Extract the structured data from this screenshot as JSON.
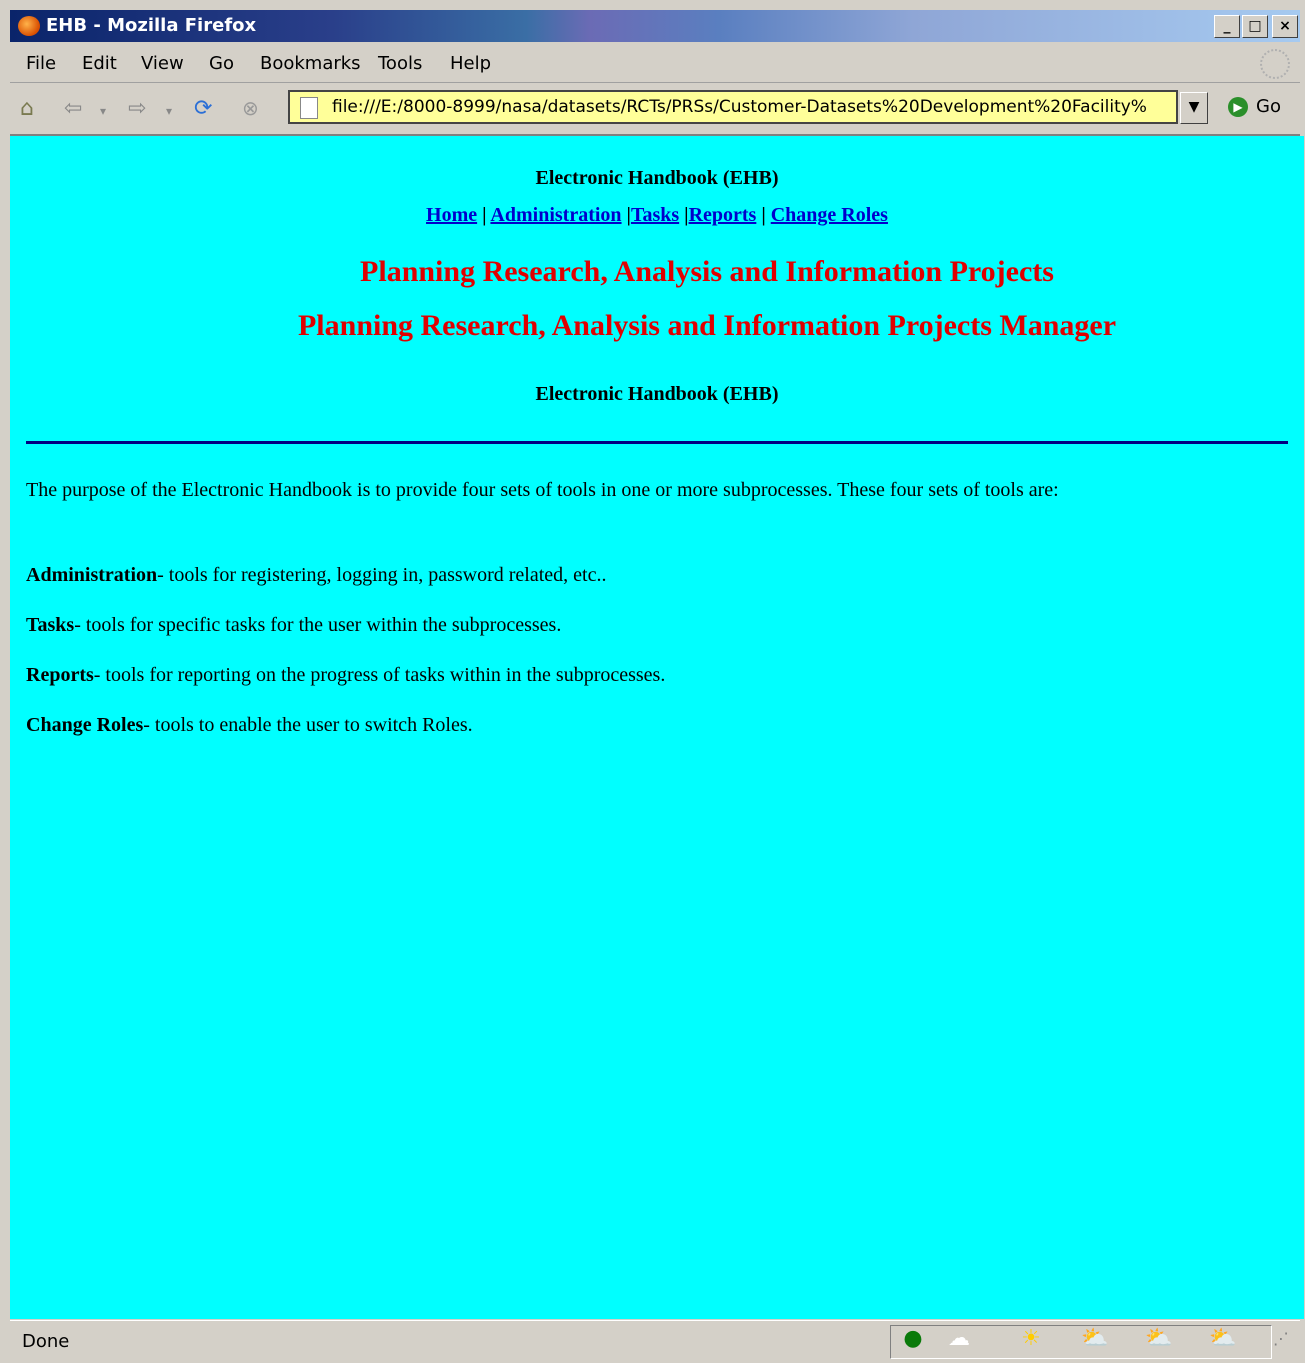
{
  "window": {
    "title": "EHB - Mozilla Firefox",
    "minimize": "_",
    "maximize": "□",
    "close": "×"
  },
  "menu": [
    "File",
    "Edit",
    "View",
    "Go",
    "Bookmarks",
    "Tools",
    "Help"
  ],
  "toolbar": {
    "url": "file:///E:/8000-8999/nasa/datasets/RCTs/PRSs/Customer-Datasets%20Development%20Facility%",
    "go_label": "Go"
  },
  "page": {
    "ehb_top": "Electronic Handbook (EHB)",
    "nav": {
      "home": "Home",
      "administration": "Administration",
      "tasks": "Tasks",
      "reports": "Reports",
      "change_roles": "Change Roles",
      "sep": "|"
    },
    "heading1": "Planning Research, Analysis and Information Projects",
    "heading2": "Planning Research, Analysis and Information Projects Manager",
    "ehb_bottom": "Electronic Handbook (EHB)",
    "intro": "The purpose of the Electronic Handbook is to provide four sets of tools in one or more subprocesses. These four sets of tools are:",
    "items": [
      {
        "term": "Administration",
        "desc": "- tools for registering, logging in, password related, etc.."
      },
      {
        "term": "Tasks",
        "desc": "- tools for specific tasks for the user within the subprocesses."
      },
      {
        "term": "Reports",
        "desc": "- tools for reporting on the progress of tasks within in the subprocesses."
      },
      {
        "term": "Change Roles",
        "desc": "- tools to enable the user to switch Roles."
      }
    ]
  },
  "status": {
    "text": "Done"
  }
}
